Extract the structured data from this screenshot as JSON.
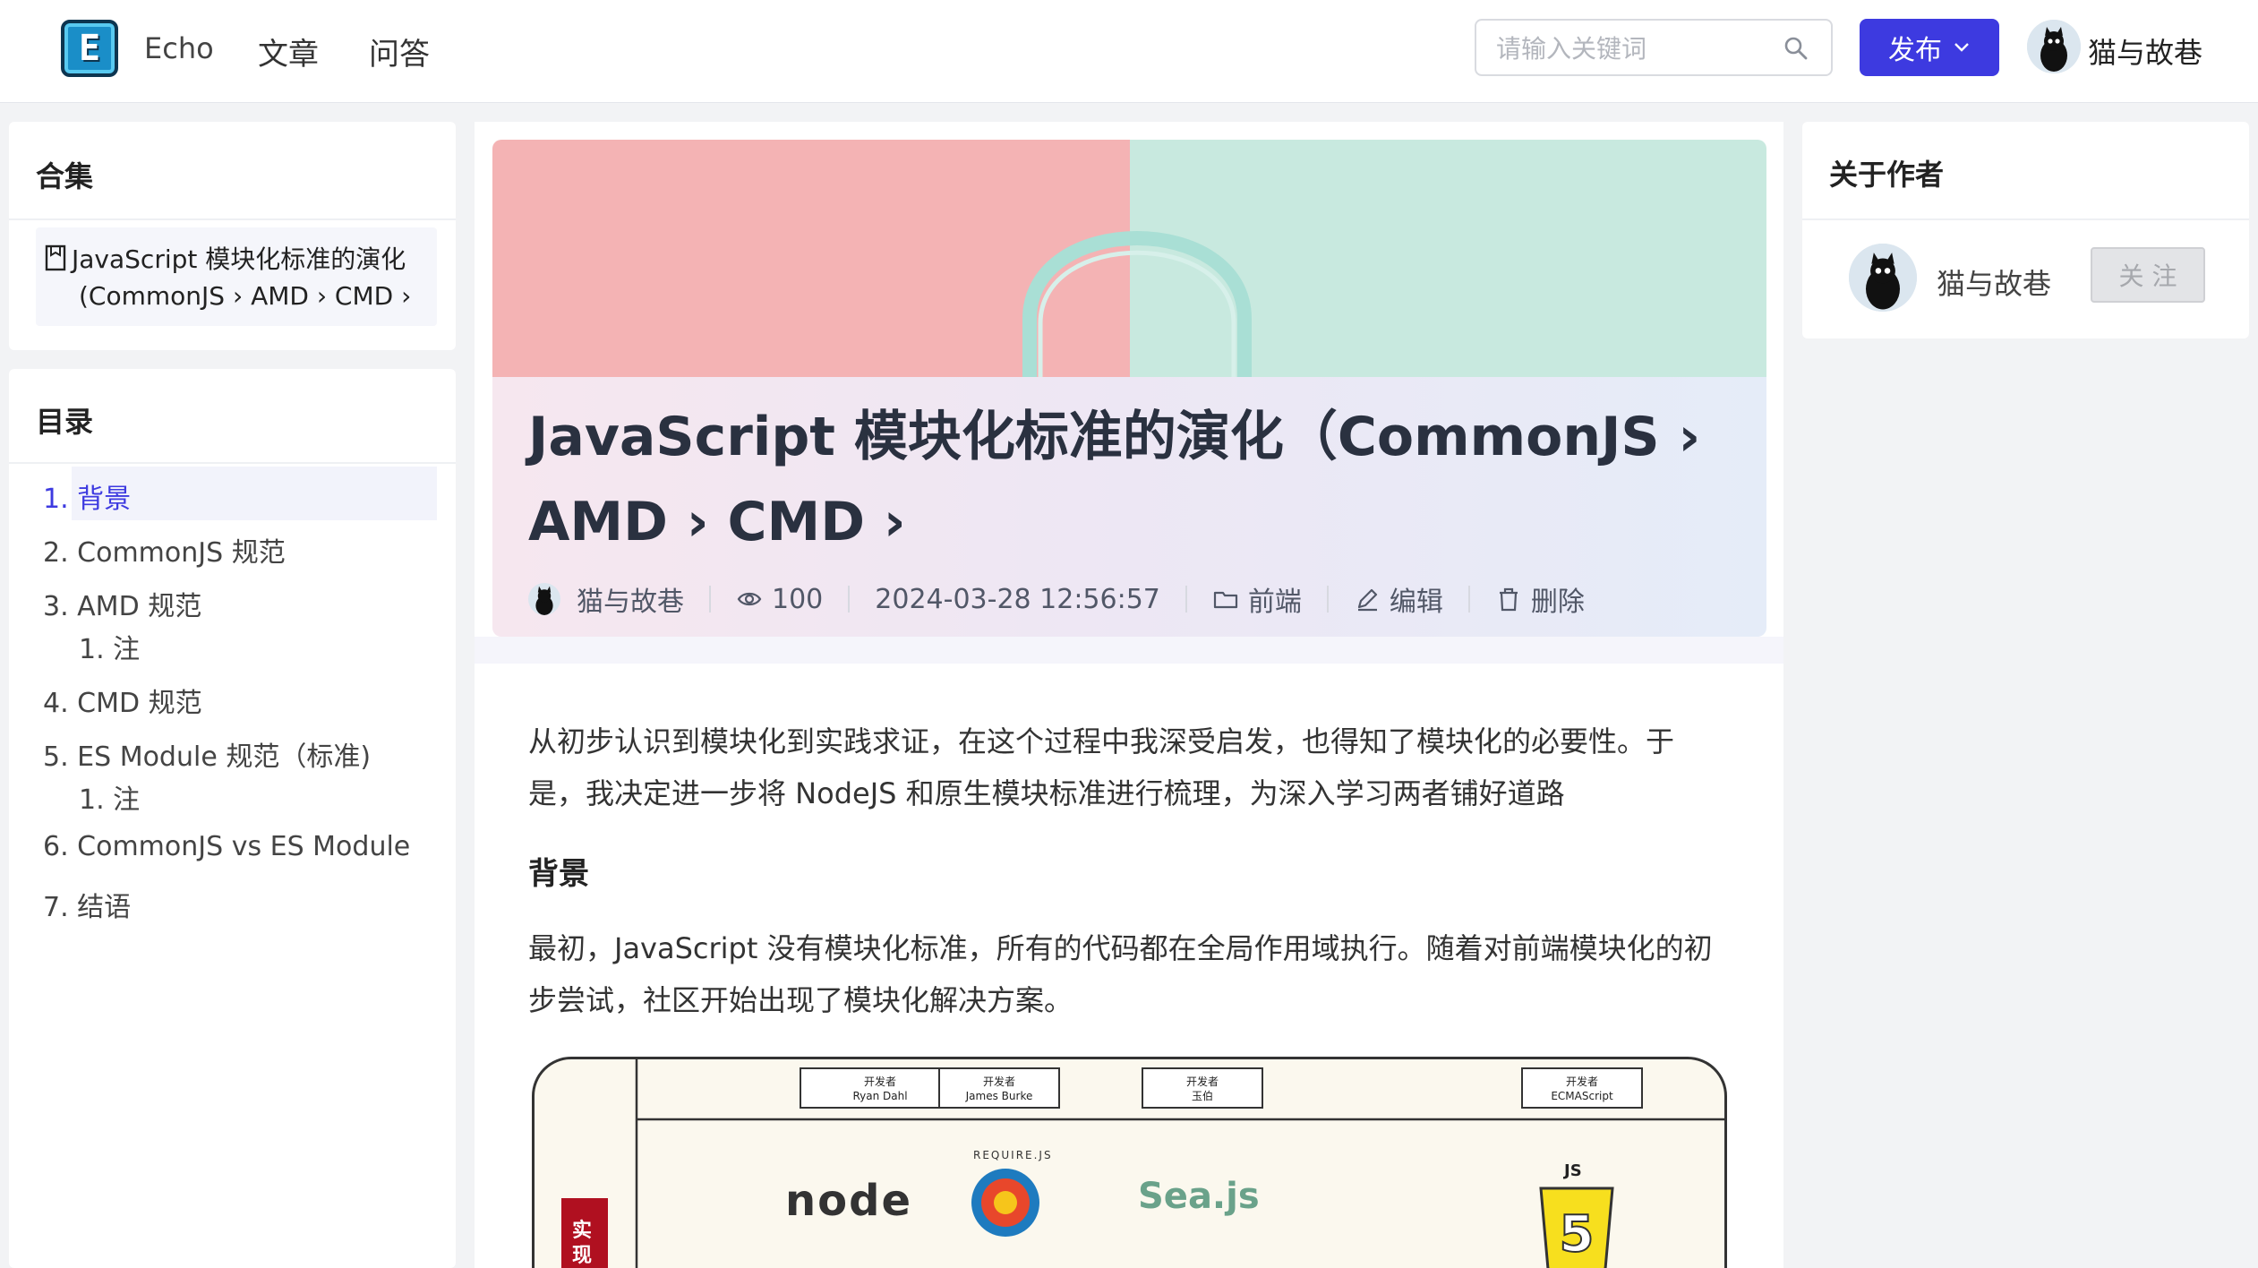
{
  "header": {
    "logo_letter": "E",
    "brand": "Echo",
    "nav": [
      "文章",
      "问答"
    ],
    "search_placeholder": "请输入关键词",
    "publish_label": "发布",
    "user_name": "猫与故巷"
  },
  "left_sidebar": {
    "collection": {
      "title": "合集",
      "item_line1": "JavaScript 模块化标准的演化",
      "item_line2": "(CommonJS › AMD › CMD ›"
    },
    "toc": {
      "title": "目录",
      "items": [
        {
          "label": "1. 背景",
          "active": true
        },
        {
          "label": "2. CommonJS 规范"
        },
        {
          "label": "3. AMD 规范"
        },
        {
          "label": "1. 注"
        },
        {
          "label": "4. CMD 规范"
        },
        {
          "label": "5. ES Module 规范（标准)"
        },
        {
          "label": "1. 注"
        },
        {
          "label": "6. CommonJS vs ES Module"
        },
        {
          "label": "7. 结语"
        }
      ]
    }
  },
  "article": {
    "title": "JavaScript 模块化标准的演化（CommonJS › AMD › CMD ›",
    "meta": {
      "author": "猫与故巷",
      "views": "100",
      "date": "2024-03-28 12:56:57",
      "category": "前端",
      "edit_label": "编辑",
      "delete_label": "删除"
    },
    "intro": "从初步认识到模块化到实践求证，在这个过程中我深受启发，也得知了模块化的必要性。于是，我决定进一步将 NodeJS 和原生模块标准进行梳理，为深入学习两者铺好道路",
    "section1_heading": "背景",
    "section1_body": "最初，JavaScript 没有模块化标准，所有的代码都在全局作用域执行。随着对前端模块化的初步尝试，社区开始出现了模块化解决方案。",
    "figure": {
      "developer_label": "开发者",
      "developers": [
        "Ryan Dahl",
        "James Burke",
        "玉伯",
        "ECMAScript"
      ],
      "side_label": "实现",
      "logos": [
        "node",
        "REQUIRE.JS",
        "Sea.js",
        "JS"
      ]
    }
  },
  "right_sidebar": {
    "title": "关于作者",
    "author_name": "猫与故巷",
    "follow_label": "关 注"
  },
  "colors": {
    "accent": "#3d3ae0",
    "page_bg": "#f2f3f5",
    "hero_left": "#f4b1b2",
    "hero_right": "#c7e9df"
  }
}
